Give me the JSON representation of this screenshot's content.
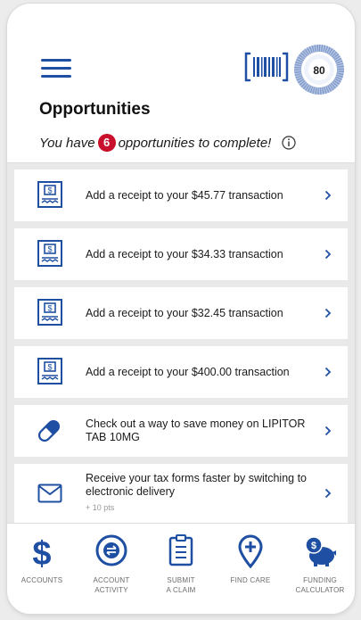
{
  "header": {
    "score": "80",
    "title": "Opportunities",
    "subtitle_prefix": "You have",
    "opportunity_count": "6",
    "subtitle_suffix": "opportunities to complete!"
  },
  "opportunities": [
    {
      "icon": "receipt-icon",
      "text": "Add a receipt to your $45.77 transaction"
    },
    {
      "icon": "receipt-icon",
      "text": "Add a receipt to your $34.33 transaction"
    },
    {
      "icon": "receipt-icon",
      "text": "Add a receipt to your $32.45 transaction"
    },
    {
      "icon": "receipt-icon",
      "text": "Add a receipt to your $400.00 transaction"
    },
    {
      "icon": "pill-icon",
      "text": "Check out a way to save money on LIPITOR TAB 10MG"
    },
    {
      "icon": "envelope-icon",
      "text": "Receive your tax forms faster by switching to electronic delivery",
      "points": "+ 10 pts"
    }
  ],
  "nav": [
    {
      "icon": "dollar-icon",
      "label": "ACCOUNTS"
    },
    {
      "icon": "account-activity-icon",
      "label": "ACCOUNT\nACTIVITY"
    },
    {
      "icon": "clipboard-icon",
      "label": "SUBMIT\nA CLAIM"
    },
    {
      "icon": "location-pin-plus-icon",
      "label": "FIND CARE"
    },
    {
      "icon": "piggy-bank-icon",
      "label": "FUNDING\nCALCULATOR"
    }
  ],
  "colors": {
    "brand_blue": "#1f4fa3",
    "badge_red": "#c8102e",
    "list_background": "#e9e9e9"
  }
}
